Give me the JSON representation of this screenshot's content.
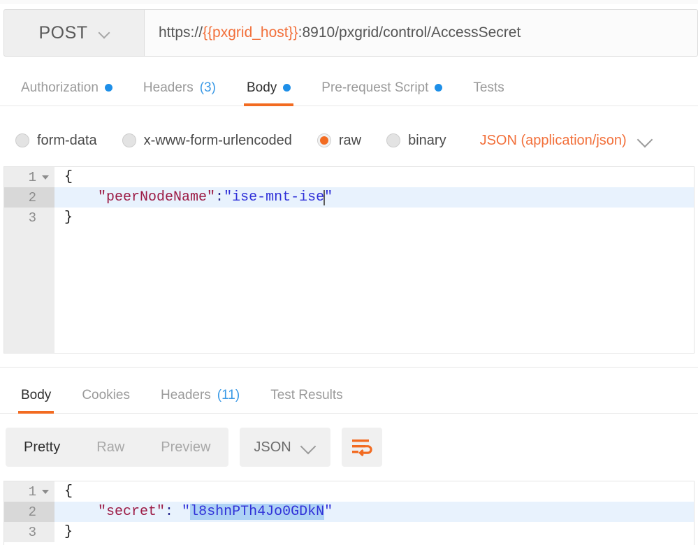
{
  "request": {
    "method": "POST",
    "method_caret_icon": "chevron-down-icon",
    "url_prefix": "https://",
    "url_variable": "{{pxgrid_host}}",
    "url_suffix": ":8910/pxgrid/control/AccessSecret",
    "url_full": "https://{{pxgrid_host}}:8910/pxgrid/control/AccessSecret",
    "tabs": [
      {
        "label": "Authorization",
        "badge_dot": true,
        "count": "",
        "active": false
      },
      {
        "label": "Headers",
        "badge_dot": false,
        "count": "(3)",
        "active": false
      },
      {
        "label": "Body",
        "badge_dot": true,
        "count": "",
        "active": true
      },
      {
        "label": "Pre-request Script",
        "badge_dot": true,
        "count": "",
        "active": false
      },
      {
        "label": "Tests",
        "badge_dot": false,
        "count": "",
        "active": false
      }
    ],
    "body_types": [
      {
        "label": "form-data",
        "selected": false
      },
      {
        "label": "x-www-form-urlencoded",
        "selected": false
      },
      {
        "label": "raw",
        "selected": true
      },
      {
        "label": "binary",
        "selected": false
      }
    ],
    "content_type": "JSON (application/json)",
    "content_type_caret_icon": "chevron-down-icon",
    "body_code": {
      "line1_no": "1",
      "line1_text": "{",
      "line2_no": "2",
      "line2_key": "\"peerNodeName\"",
      "line2_colon": ":",
      "line2_value_open": "\"",
      "line2_value": "ise-mnt-ise",
      "line2_value_close": "\"",
      "line3_no": "3",
      "line3_text": "}"
    }
  },
  "response": {
    "tabs": [
      {
        "label": "Body",
        "count": "",
        "active": true
      },
      {
        "label": "Cookies",
        "count": "",
        "active": false
      },
      {
        "label": "Headers",
        "count": "(11)",
        "active": false
      },
      {
        "label": "Test Results",
        "count": "",
        "active": false
      }
    ],
    "view_modes": [
      {
        "label": "Pretty",
        "active": true
      },
      {
        "label": "Raw",
        "active": false
      },
      {
        "label": "Preview",
        "active": false
      }
    ],
    "format": "JSON",
    "format_caret_icon": "chevron-down-icon",
    "wrap_icon": "wrap-lines-icon",
    "body_code": {
      "line1_no": "1",
      "line1_text": "{",
      "line2_no": "2",
      "line2_key": "\"secret\"",
      "line2_colon": ": ",
      "line2_value_open": "\"",
      "line2_value": "l8shnPTh4Jo0GDkN",
      "line2_value_close": "\"",
      "line3_no": "3",
      "line3_text": "}"
    }
  },
  "colors": {
    "accent_orange": "#f26b21",
    "variable_orange": "#f2703b",
    "dot_blue": "#1e8fe8",
    "count_blue": "#3b9ae6",
    "json_key": "#9c1b45",
    "json_string": "#2f30d8",
    "selection_blue": "#aed2f5",
    "active_line": "#e8f2fd"
  }
}
